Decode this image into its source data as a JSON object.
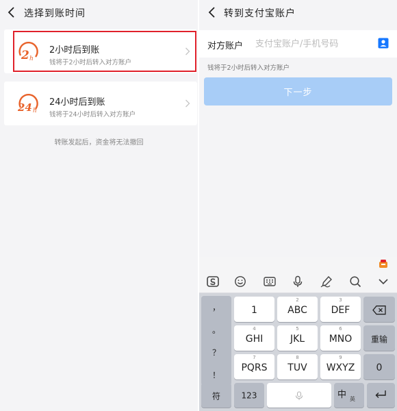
{
  "left": {
    "title": "选择到账时间",
    "options": [
      {
        "logo_text": "2h",
        "title": "2小时后到账",
        "subtitle": "钱将于2小时后转入对方账户"
      },
      {
        "logo_text": "24h",
        "title": "24小时后到账",
        "subtitle": "钱将于24小时后转入对方账户"
      }
    ],
    "note": "转账发起后，资金将无法撤回",
    "accent_color": "#e0202a",
    "logo_color": "#e8622a"
  },
  "right": {
    "title": "转到支付宝账户",
    "field_label": "对方账户",
    "field_value": "",
    "field_placeholder": "支付宝账户/手机号码",
    "hint": "钱将于2小时后转入对方账户",
    "next_label": "下一步",
    "next_color": "#a8cdf7",
    "contact_icon_color": "#1677ff"
  },
  "keyboard": {
    "toolbar_icons": [
      "sogou-icon",
      "emoji-icon",
      "keyboard-icon",
      "microphone-icon",
      "handwriting-icon",
      "search-icon",
      "collapse-icon"
    ],
    "symbols": [
      "，",
      "。",
      "？",
      "！"
    ],
    "keys": [
      {
        "num": "1",
        "label": "1"
      },
      {
        "num": "2",
        "label": "ABC"
      },
      {
        "num": "3",
        "label": "DEF"
      },
      {
        "num": "4",
        "label": "GHI"
      },
      {
        "num": "5",
        "label": "JKL"
      },
      {
        "num": "6",
        "label": "MNO"
      },
      {
        "num": "7",
        "label": "PQRS"
      },
      {
        "num": "8",
        "label": "TUV"
      },
      {
        "num": "9",
        "label": "WXYZ"
      }
    ],
    "backspace": "⌫",
    "reset": "重输",
    "zero": "0",
    "bottom": {
      "symbol": "符",
      "num123": "123",
      "space": "",
      "lang_main": "中",
      "lang_sub": "英",
      "enter": "↵"
    }
  }
}
